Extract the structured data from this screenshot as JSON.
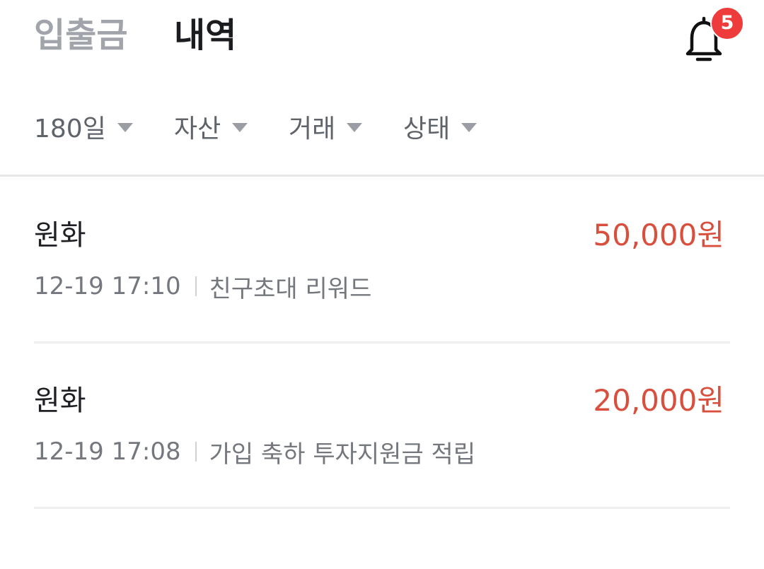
{
  "header": {
    "tabs": [
      {
        "label": "입출금",
        "active": false
      },
      {
        "label": "내역",
        "active": true
      }
    ],
    "notifications": {
      "icon": "bell-icon",
      "count": "5",
      "badge_color": "#ee3b3b"
    }
  },
  "filters": [
    {
      "label": "180일"
    },
    {
      "label": "자산"
    },
    {
      "label": "거래"
    },
    {
      "label": "상태"
    }
  ],
  "transactions": [
    {
      "asset": "원화",
      "amount": "50,000원",
      "datetime": "12-19 17:10",
      "description": "친구초대 리워드"
    },
    {
      "asset": "원화",
      "amount": "20,000원",
      "datetime": "12-19 17:08",
      "description": "가입 축하 투자지원금 적립"
    }
  ],
  "colors": {
    "amount_positive": "#d94f3d",
    "active_tab": "#1a1c20",
    "inactive_tab": "#a1a5ab"
  }
}
